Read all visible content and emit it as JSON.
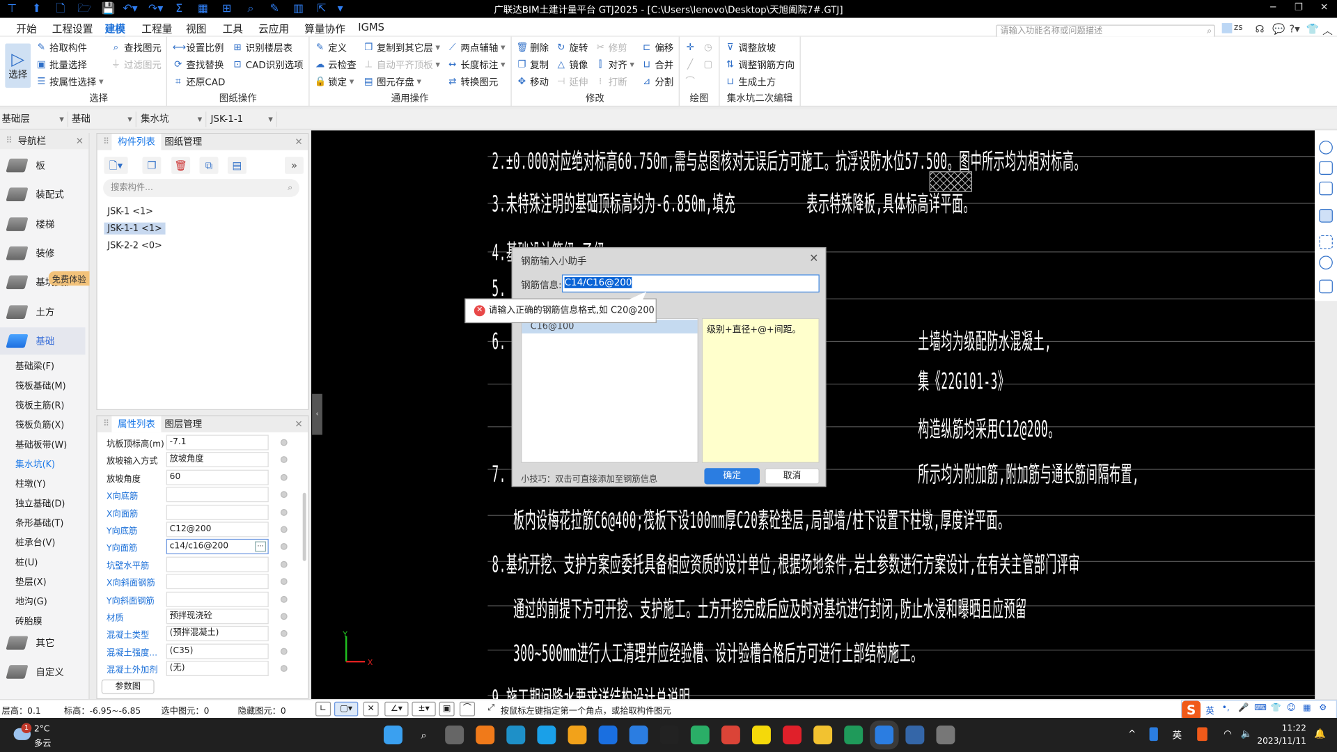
{
  "window": {
    "title": "广联达BIM土建计量平台 GTJ2025 - [C:\\Users\\lenovo\\Desktop\\天旭阖院7#.GTJ]",
    "controls": [
      "─",
      "❐",
      "✕"
    ]
  },
  "quick_access": [
    "app-logo",
    "new-icon",
    "new-file-icon",
    "open-icon",
    "save-icon",
    "undo-icon",
    "redo-icon",
    "sum-icon",
    "calc-icon",
    "grid-icon",
    "find-icon",
    "pen-icon",
    "film-icon",
    "export-icon",
    "more-icon"
  ],
  "menu": {
    "tabs": [
      "开始",
      "工程设置",
      "建模",
      "工程量",
      "视图",
      "工具",
      "云应用",
      "算量协作",
      "IGMS"
    ],
    "active": 2,
    "search_placeholder": "请输入功能名称或问题描述",
    "user": "zs"
  },
  "ribbon": {
    "select_big": "选择",
    "groups": [
      {
        "label": "选择",
        "columns": [
          [
            {
              "label": "拾取构件",
              "icon": "✎"
            },
            {
              "label": "批量选择",
              "icon": "▣"
            },
            {
              "label": "按属性选择",
              "icon": "☰",
              "dropdown": true
            }
          ],
          [
            {
              "label": "查找图元",
              "icon": "⌕"
            },
            {
              "label": "过滤图元",
              "icon": "⏚",
              "disabled": true
            }
          ]
        ]
      },
      {
        "label": "图纸操作",
        "columns": [
          [
            {
              "label": "设置比例",
              "icon": "⟷"
            },
            {
              "label": "查找替换",
              "icon": "⟳"
            },
            {
              "label": "还原CAD",
              "icon": "⌗"
            }
          ],
          [
            {
              "label": "识别楼层表",
              "icon": "⊞"
            },
            {
              "label": "CAD识别选项",
              "icon": "⊡"
            }
          ]
        ]
      },
      {
        "label": "通用操作",
        "columns": [
          [
            {
              "label": "定义",
              "icon": "✎"
            },
            {
              "label": "云检查",
              "icon": "☁"
            },
            {
              "label": "锁定",
              "icon": "🔒",
              "dropdown": true
            }
          ],
          [
            {
              "label": "复制到其它层",
              "icon": "❐",
              "dropdown": true
            },
            {
              "label": "自动平齐顶板",
              "icon": "⊥",
              "disabled": true,
              "dropdown": true
            },
            {
              "label": "图元存盘",
              "icon": "▤",
              "dropdown": true
            }
          ],
          [
            {
              "label": "两点辅轴",
              "icon": "⟋",
              "dropdown": true
            },
            {
              "label": "长度标注",
              "icon": "↔",
              "dropdown": true
            },
            {
              "label": "转换图元",
              "icon": "⇄"
            }
          ]
        ]
      },
      {
        "label": "修改",
        "columns": [
          [
            {
              "label": "删除",
              "icon": "🗑"
            },
            {
              "label": "复制",
              "icon": "❐"
            },
            {
              "label": "移动",
              "icon": "✥"
            }
          ],
          [
            {
              "label": "旋转",
              "icon": "↻"
            },
            {
              "label": "镜像",
              "icon": "△"
            },
            {
              "label": "延伸",
              "icon": "⊣",
              "disabled": true
            }
          ],
          [
            {
              "label": "修剪",
              "icon": "✂",
              "disabled": true
            },
            {
              "label": "对齐",
              "icon": "⫿",
              "dropdown": true
            },
            {
              "label": "打断",
              "icon": "⁞",
              "disabled": true
            }
          ],
          [
            {
              "label": "偏移",
              "icon": "⊏"
            },
            {
              "label": "合并",
              "icon": "⊔"
            },
            {
              "label": "分割",
              "icon": "⊿"
            }
          ]
        ]
      },
      {
        "label": "绘图",
        "columns": [
          [
            {
              "label": "",
              "icon": "✛"
            },
            {
              "label": "",
              "icon": "╱",
              "disabled": true
            },
            {
              "label": "",
              "icon": "⌒",
              "disabled": true
            }
          ],
          [
            {
              "label": "",
              "icon": "◷",
              "disabled": true
            },
            {
              "label": "",
              "icon": "▢",
              "disabled": true
            }
          ]
        ]
      },
      {
        "label": "集水坑二次编辑",
        "columns": [
          [
            {
              "label": "调整放坡",
              "icon": "⊽"
            },
            {
              "label": "调整钢筋方向",
              "icon": "⇅"
            },
            {
              "label": "生成土方",
              "icon": "⊔"
            }
          ]
        ]
      }
    ]
  },
  "selectors": [
    "基础层",
    "基础",
    "集水坑",
    "JSK-1-1"
  ],
  "nav": {
    "title": "导航栏",
    "items": [
      "板",
      "装配式",
      "楼梯",
      "装修",
      "基坑支护",
      "土方",
      "基础"
    ],
    "selected": "基础",
    "badge": "免费体验",
    "sub_items": [
      "基础梁(F)",
      "筏板基础(M)",
      "筏板主筋(R)",
      "筏板负筋(X)",
      "基础板带(W)",
      "集水坑(K)",
      "柱墩(Y)",
      "独立基础(D)",
      "条形基础(T)",
      "桩承台(V)",
      "桩(U)",
      "垫层(X)",
      "地沟(G)",
      "砖胎膜"
    ],
    "sub_selected": "集水坑(K)",
    "bottom_items": [
      "其它",
      "自定义"
    ]
  },
  "component_panel": {
    "tabs": [
      "构件列表",
      "图纸管理"
    ],
    "toolbar": [
      "new-icon",
      "dropdown-icon",
      "copy-icon",
      "delete-icon",
      "layer-copy-icon",
      "save-icon",
      "more-icon"
    ],
    "search_placeholder": "搜索构件...",
    "items": [
      "JSK-1 <1>",
      "JSK-1-1 <1>",
      "JSK-2-2 <0>"
    ],
    "selected": 1
  },
  "properties_panel": {
    "tabs": [
      "属性列表",
      "图层管理"
    ],
    "rows": [
      {
        "label": "坑板顶标高(m)",
        "value": "-7.1",
        "custom": false
      },
      {
        "label": "放坡输入方式",
        "value": "放坡角度",
        "custom": false
      },
      {
        "label": "放坡角度",
        "value": "60",
        "custom": false
      },
      {
        "label": "X向底筋",
        "value": "",
        "custom": true
      },
      {
        "label": "X向面筋",
        "value": "",
        "custom": true
      },
      {
        "label": "Y向底筋",
        "value": "C12@200",
        "custom": true
      },
      {
        "label": "Y向面筋",
        "value": "c14/c16@200",
        "custom": true,
        "focused": true
      },
      {
        "label": "坑壁水平筋",
        "value": "",
        "custom": true
      },
      {
        "label": "X向斜面钢筋",
        "value": "",
        "custom": true
      },
      {
        "label": "Y向斜面钢筋",
        "value": "",
        "custom": true
      },
      {
        "label": "材质",
        "value": "预拌现浇砼",
        "custom": true
      },
      {
        "label": "混凝土类型",
        "value": "(预拌混凝土)",
        "custom": true
      },
      {
        "label": "混凝土强度...",
        "value": "(C35)",
        "custom": true
      },
      {
        "label": "混凝土外加剂",
        "value": "(无)",
        "custom": true
      }
    ],
    "custom_label_color": "#1a6fd8",
    "param_button": "参数图"
  },
  "cad_drawing": {
    "lines": [
      "2.±0.000对应绝对标高60.750m,需与总图核对无误后方可施工。抗浮设防水位57.500。图中所示均为相对标高。",
      "3.未特殊注明的基础顶标高均为-6.850m,填充          表示特殊降板,具体标高详平面。",
      "4.基础设计等级:乙级。",
      "5.",
      "6.                                                          土墙均为级配防水混凝土,",
      "                                                            集《22G101-3》",
      "                                                            构造纵筋均采用C12@200。",
      "7.                                                          所示均为附加筋,附加筋与通长筋间隔布置,",
      "   板内设梅花拉筋C6@400;筏板下设100mm厚C20素砼垫层,局部墙/柱下设置下柱墩,厚度详平面。",
      "8.基坑开挖、支护方案应委托具备相应资质的设计单位,根据场地条件,岩土参数进行方案设计,在有关主管部门评审",
      "   通过的前提下方可开挖、支护施工。土方开挖完成后应及时对基坑进行封闭,防止水浸和曝晒且应预留",
      "   300~500mm进行人工清理并应经验槽、设计验槽合格后方可进行上部结构施工。",
      "9.施工期间降水要求详结构设计总说明。"
    ],
    "axis": {
      "x": "X",
      "y": "Y",
      "x_color": "#e02020",
      "y_color": "#20c020"
    }
  },
  "dialog": {
    "title": "钢筋输入小助手",
    "field_label": "钢筋信息:",
    "field_value": "C14/C16@200",
    "list_items": [
      "C16@100"
    ],
    "hint": "级别+直径+@+间距。",
    "tip": "小技巧：双击可直接添加至钢筋信息",
    "ok": "确定",
    "cancel": "取消",
    "error_tooltip": "请输入正确的钢筋信息格式,如 C20@200"
  },
  "status_bar": {
    "floor_height": "层高：0.1",
    "elevation": "标高：-6.95~-6.85",
    "selected": "选中图元：0",
    "hidden": "隐藏图元：0",
    "message": "按鼠标左键指定第一个角点，或拾取构件图元",
    "ime": [
      "英",
      "•,",
      "🎤",
      "⌨",
      "👕",
      "☺",
      "▦",
      "⚙"
    ]
  },
  "taskbar": {
    "weather_temp": "2°C",
    "weather_desc": "多云",
    "weather_badge": "1",
    "apps": [
      "start-icon",
      "search-icon",
      "taskview-icon",
      "app-orange-icon",
      "edge-icon",
      "video-icon",
      "shield-icon",
      "feishu-icon",
      "lark-icon",
      "qq-icon",
      "wechat-icon",
      "chrome-icon",
      "qqmusic-icon",
      "netease-icon",
      "explorer-icon",
      "wps-icon",
      "gtj-icon",
      "cad-icon",
      "robot-icon"
    ],
    "tray_lang": "英",
    "time": "11:22",
    "date": "2023/11/11"
  }
}
